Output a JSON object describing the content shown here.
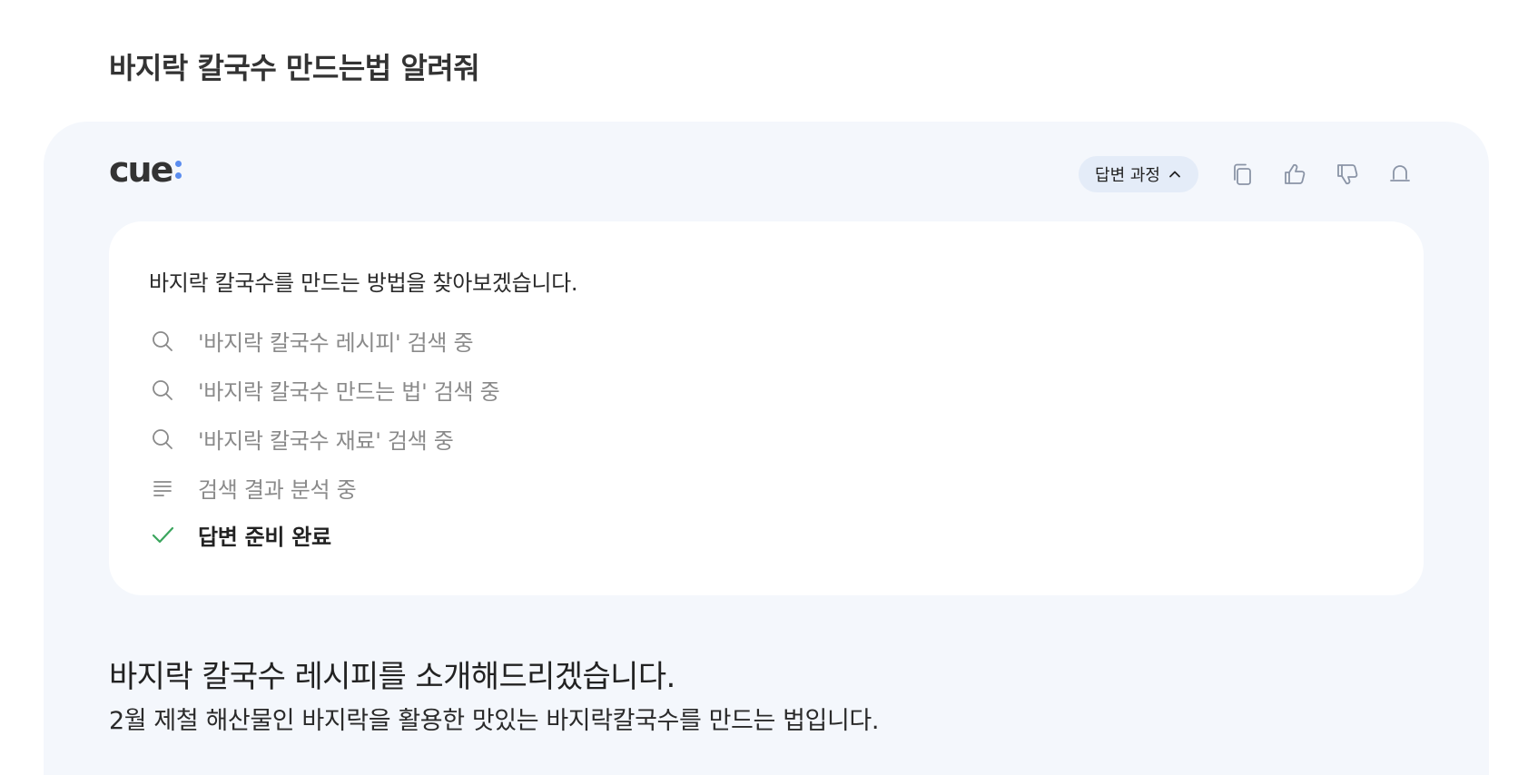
{
  "question": "바지락 칼국수 만드는법 알려줘",
  "logo": {
    "text": "cue"
  },
  "toolbar": {
    "process_toggle_label": "답변 과정",
    "icons": [
      "copy-icon",
      "thumbs-up-icon",
      "thumbs-down-icon",
      "bell-icon"
    ]
  },
  "process": {
    "intro": "바지락 칼국수를 만드는 방법을 찾아보겠습니다.",
    "steps": [
      {
        "icon": "search-icon",
        "text": "'바지락 칼국수 레시피' 검색 중"
      },
      {
        "icon": "search-icon",
        "text": "'바지락 칼국수 만드는 법' 검색 중"
      },
      {
        "icon": "search-icon",
        "text": "'바지락 칼국수 재료' 검색 중"
      },
      {
        "icon": "lines-icon",
        "text": "검색 결과 분석 중"
      },
      {
        "icon": "check-icon",
        "text": "답변 준비 완료"
      }
    ]
  },
  "answer": {
    "heading": "바지락 칼국수 레시피를 소개해드리겠습니다.",
    "subtitle": "2월 제철 해산물인 바지락을 활용한 맛있는 바지락칼국수를 만드는 법입니다."
  },
  "colors": {
    "panel_bg": "#f4f7fc",
    "toggle_bg": "#e4ecf8",
    "accent_blue": "#5b8def",
    "check_green": "#3aa55d",
    "muted_text": "#8a8a8a"
  }
}
